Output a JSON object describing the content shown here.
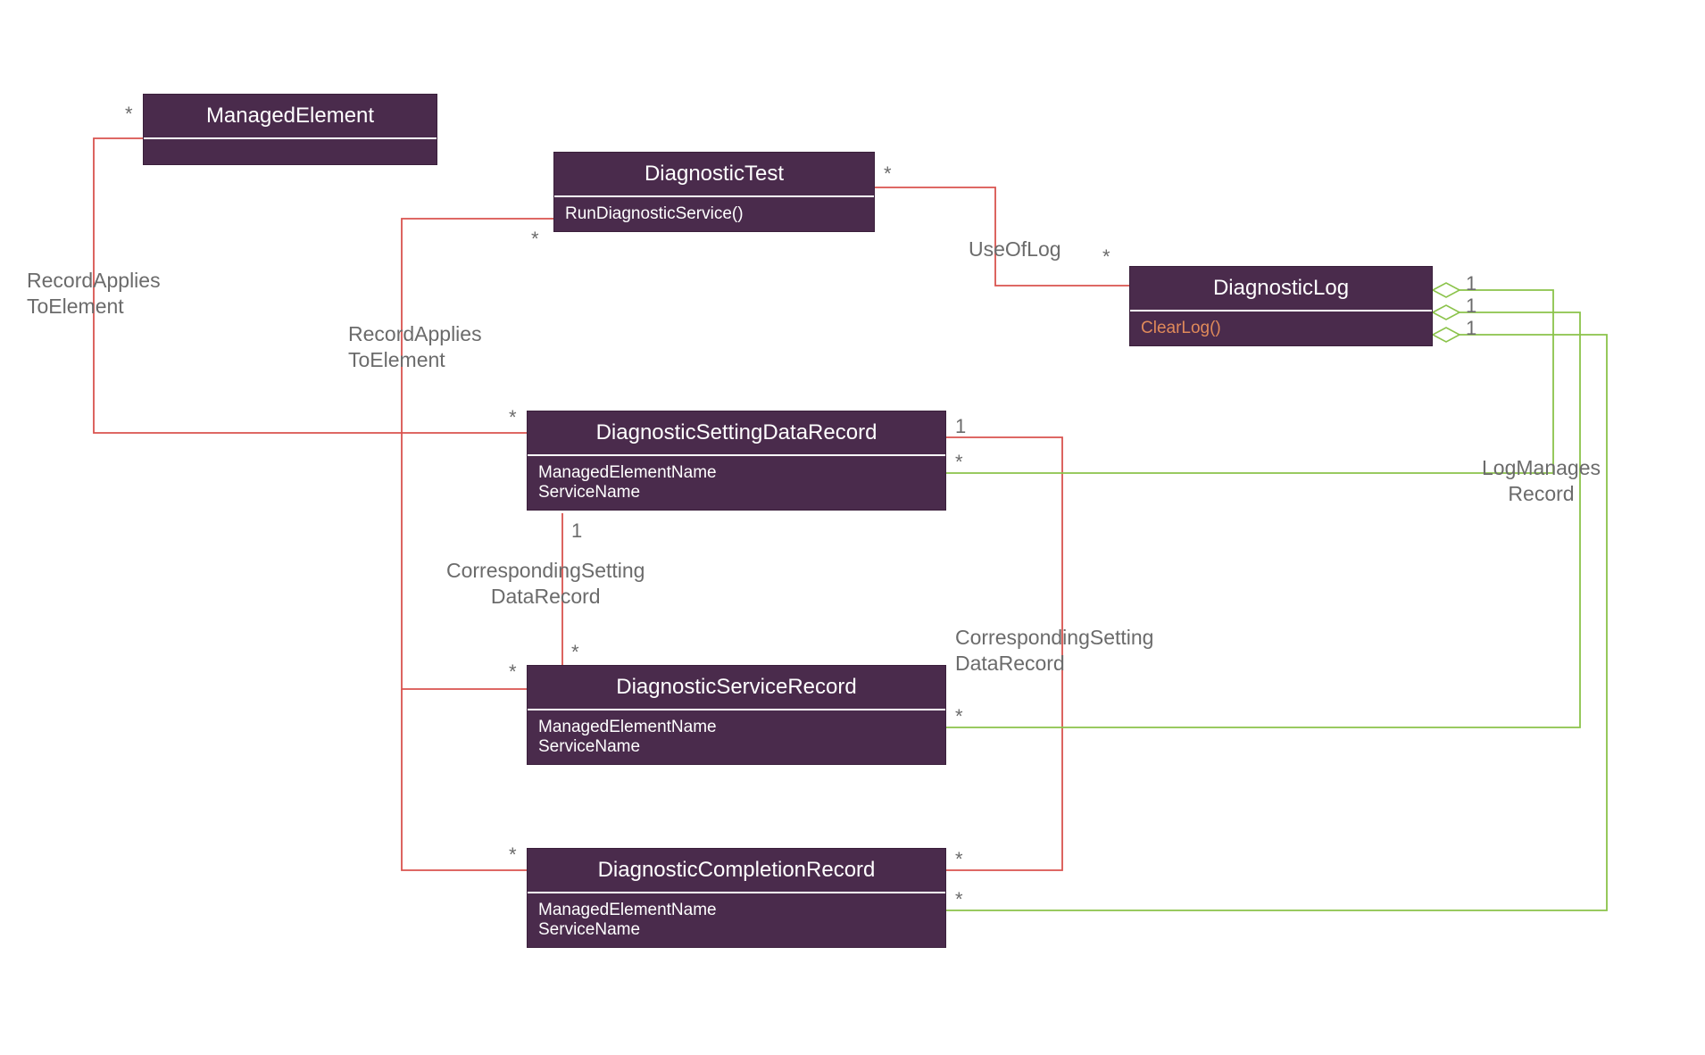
{
  "diagram": {
    "classes": {
      "managedElement": {
        "title": "ManagedElement"
      },
      "diagnosticTest": {
        "title": "DiagnosticTest",
        "op": "RunDiagnosticService()"
      },
      "diagnosticLog": {
        "title": "DiagnosticLog",
        "op": "ClearLog()"
      },
      "settingDataRecord": {
        "title": "DiagnosticSettingDataRecord",
        "attr1": "ManagedElementName",
        "attr2": "ServiceName"
      },
      "serviceRecord": {
        "title": "DiagnosticServiceRecord",
        "attr1": "ManagedElementName",
        "attr2": "ServiceName"
      },
      "completionRecord": {
        "title": "DiagnosticCompletionRecord",
        "attr1": "ManagedElementName",
        "attr2": "ServiceName"
      }
    },
    "associations": {
      "recordApplies1": "RecordApplies\nToElement",
      "recordApplies2": "RecordApplies\nToElement",
      "useOfLog": "UseOfLog",
      "correspondingSetting1": "CorrespondingSetting\nDataRecord",
      "correspondingSetting2": "CorrespondingSetting\nDataRecord",
      "logManagesRecord": "LogManages\nRecord"
    },
    "multiplicities": {
      "star": "*",
      "one": "1"
    }
  },
  "chart_data": {
    "type": "uml_class_diagram",
    "classes": [
      {
        "name": "ManagedElement",
        "attributes": [],
        "operations": []
      },
      {
        "name": "DiagnosticTest",
        "attributes": [],
        "operations": [
          "RunDiagnosticService()"
        ]
      },
      {
        "name": "DiagnosticLog",
        "attributes": [],
        "operations": [
          "ClearLog()"
        ]
      },
      {
        "name": "DiagnosticSettingDataRecord",
        "attributes": [
          "ManagedElementName",
          "ServiceName"
        ],
        "operations": []
      },
      {
        "name": "DiagnosticServiceRecord",
        "attributes": [
          "ManagedElementName",
          "ServiceName"
        ],
        "operations": []
      },
      {
        "name": "DiagnosticCompletionRecord",
        "attributes": [
          "ManagedElementName",
          "ServiceName"
        ],
        "operations": []
      }
    ],
    "relationships": [
      {
        "name": "RecordAppliesToElement",
        "from": "ManagedElement",
        "to": "DiagnosticSettingDataRecord",
        "from_mult": "*",
        "to_mult": "*",
        "type": "association"
      },
      {
        "name": "RecordAppliesToElement",
        "from": "DiagnosticTest",
        "to": "DiagnosticServiceRecord",
        "from_mult": "*",
        "to_mult": "*",
        "type": "association"
      },
      {
        "name": "RecordAppliesToElement",
        "from": "DiagnosticTest",
        "to": "DiagnosticCompletionRecord",
        "from_mult": "*",
        "to_mult": "*",
        "type": "association"
      },
      {
        "name": "UseOfLog",
        "from": "DiagnosticTest",
        "to": "DiagnosticLog",
        "from_mult": "*",
        "to_mult": "*",
        "type": "association"
      },
      {
        "name": "CorrespondingSettingDataRecord",
        "from": "DiagnosticSettingDataRecord",
        "to": "DiagnosticServiceRecord",
        "from_mult": "1",
        "to_mult": "*",
        "type": "association"
      },
      {
        "name": "CorrespondingSettingDataRecord",
        "from": "DiagnosticSettingDataRecord",
        "to": "DiagnosticCompletionRecord",
        "from_mult": "1",
        "to_mult": "*",
        "type": "association"
      },
      {
        "name": "LogManagesRecord",
        "from": "DiagnosticLog",
        "to": "DiagnosticSettingDataRecord",
        "from_mult": "1",
        "to_mult": "*",
        "type": "aggregation"
      },
      {
        "name": "LogManagesRecord",
        "from": "DiagnosticLog",
        "to": "DiagnosticServiceRecord",
        "from_mult": "1",
        "to_mult": "*",
        "type": "aggregation"
      },
      {
        "name": "LogManagesRecord",
        "from": "DiagnosticLog",
        "to": "DiagnosticCompletionRecord",
        "from_mult": "1",
        "to_mult": "*",
        "type": "aggregation"
      }
    ]
  }
}
